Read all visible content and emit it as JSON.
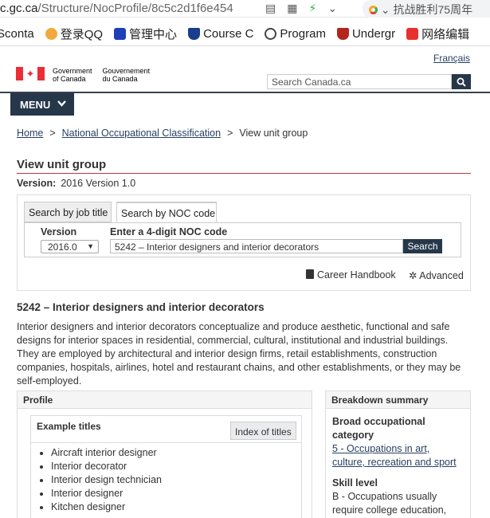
{
  "browser": {
    "url_host": "c.gc.ca",
    "url_path": "/Structure/NocProfile/8c5c2d1f6e454",
    "search_text": "抗战胜利75周年",
    "bookmarks": [
      "Sconta",
      "登录QQ",
      "管理中心",
      "Course C",
      "Program",
      "Undergr",
      "网络编辑"
    ]
  },
  "header": {
    "language_link": "Français",
    "goc_en_1": "Government",
    "goc_en_2": "of Canada",
    "goc_fr_1": "Gouvernement",
    "goc_fr_2": "du Canada",
    "search_placeholder": "Search Canada.ca",
    "menu_label": "MENU"
  },
  "breadcrumb": {
    "home": "Home",
    "noc": "National Occupational Classification",
    "current": "View unit group",
    "sep": ">"
  },
  "page": {
    "title": "View unit group",
    "version_label": "Version:",
    "version_value": "2016 Version 1.0"
  },
  "search_panel": {
    "tab_job_title": "Search by job title",
    "tab_noc_code": "Search by NOC code",
    "version_label": "Version",
    "version_selected": "2016.0",
    "noc_label": "Enter a 4-digit NOC code",
    "noc_value": "5242 – Interior designers and interior decorators",
    "search_button": "Search",
    "career_handbook": "Career Handbook",
    "advanced": "Advanced"
  },
  "unit_group": {
    "title": "5242 – Interior designers and interior decorators",
    "description": "Interior designers and interior decorators conceptualize and produce aesthetic, functional and safe designs for interior spaces in residential, commercial, cultural, institutional and industrial buildings. They are employed by architectural and interior design firms, retail establishments, construction companies, hospitals, airlines, hotel and restaurant chains, and other establishments, or they may be self-employed."
  },
  "profile": {
    "heading": "Profile",
    "example_titles_heading": "Example titles",
    "index_button": "Index of titles",
    "titles": [
      "Aircraft interior designer",
      "Interior decorator",
      "Interior design technician",
      "Interior designer",
      "Kitchen designer"
    ]
  },
  "breakdown": {
    "heading": "Breakdown summary",
    "broad_heading": "Broad occupational category",
    "broad_link": "5 - Occupations in art, culture, recreation and sport",
    "skill_heading": "Skill level",
    "skill_text": "B - Occupations usually require college education,"
  },
  "colors": {
    "navy": "#26374a",
    "link": "#284162",
    "red": "#eb2d37",
    "title_rule": "#af3c43"
  }
}
